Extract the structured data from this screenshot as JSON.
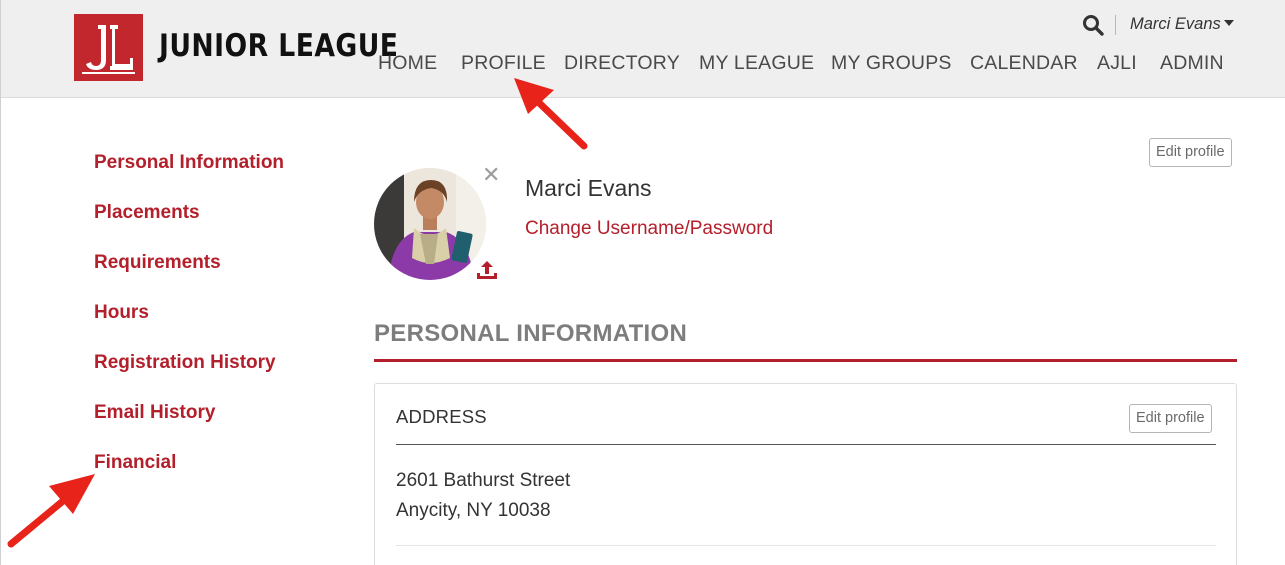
{
  "brand": {
    "name": "JUNIOR LEAGUE",
    "logo_icon": "junior-league-jl-monogram",
    "color": "#c1272d"
  },
  "nav": {
    "items": [
      {
        "id": "home",
        "label": "HOME"
      },
      {
        "id": "profile",
        "label": "PROFILE"
      },
      {
        "id": "directory",
        "label": "DIRECTORY"
      },
      {
        "id": "my-league",
        "label": "MY LEAGUE"
      },
      {
        "id": "my-groups",
        "label": "MY GROUPS"
      },
      {
        "id": "calendar",
        "label": "CALENDAR"
      },
      {
        "id": "ajli",
        "label": "AJLI"
      },
      {
        "id": "admin",
        "label": "ADMIN"
      }
    ]
  },
  "utility": {
    "search_icon": "search-icon",
    "user_name": "Marci Evans"
  },
  "sidebar": {
    "items": [
      {
        "label": "Personal Information"
      },
      {
        "label": "Placements"
      },
      {
        "label": "Requirements"
      },
      {
        "label": "Hours"
      },
      {
        "label": "Registration History"
      },
      {
        "label": "Email History"
      },
      {
        "label": "Financial"
      }
    ]
  },
  "profile": {
    "name": "Marci Evans",
    "change_credentials_link": "Change Username/Password",
    "edit_button": "Edit profile",
    "remove_photo_icon": "close-icon",
    "upload_photo_icon": "upload-icon"
  },
  "section": {
    "title": "PERSONAL INFORMATION"
  },
  "address_card": {
    "title": "ADDRESS",
    "edit_button": "Edit profile",
    "line1": "2601 Bathurst Street",
    "line2": "Anycity, NY 10038"
  },
  "colors": {
    "accent": "#b3202c",
    "header_bg": "#efefef",
    "annotation_arrow": "#e8231a"
  }
}
